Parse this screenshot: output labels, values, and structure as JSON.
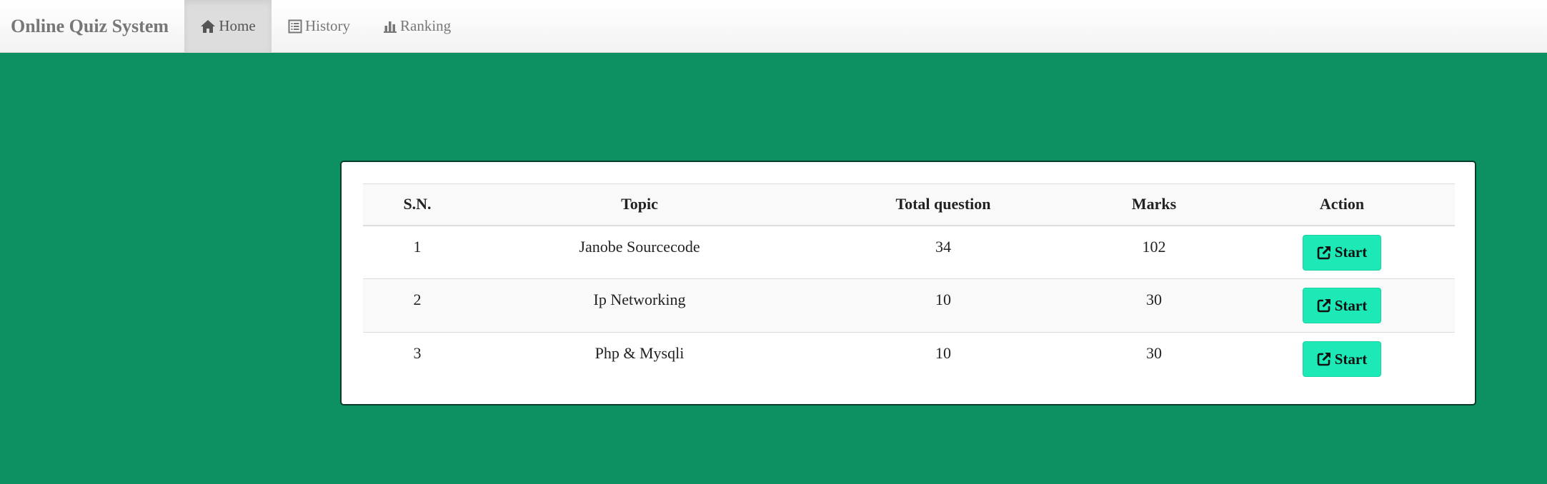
{
  "navbar": {
    "brand": "Online Quiz System",
    "items": [
      {
        "label": "Home",
        "icon": "home-icon",
        "active": true
      },
      {
        "label": "History",
        "icon": "list-alt-icon",
        "active": false
      },
      {
        "label": "Ranking",
        "icon": "stats-icon",
        "active": false
      }
    ]
  },
  "table": {
    "headers": {
      "sn": "S.N.",
      "topic": "Topic",
      "total": "Total question",
      "marks": "Marks",
      "action": "Action"
    },
    "rows": [
      {
        "sn": "1",
        "topic": "Janobe Sourcecode",
        "total": "34",
        "marks": "102",
        "action": "Start"
      },
      {
        "sn": "2",
        "topic": "Ip Networking",
        "total": "10",
        "marks": "30",
        "action": "Start"
      },
      {
        "sn": "3",
        "topic": "Php & Mysqli",
        "total": "10",
        "marks": "30",
        "action": "Start"
      }
    ]
  },
  "colors": {
    "background": "#0d9163",
    "start_button": "#1de9b6",
    "navbar": "#f8f8f8"
  }
}
